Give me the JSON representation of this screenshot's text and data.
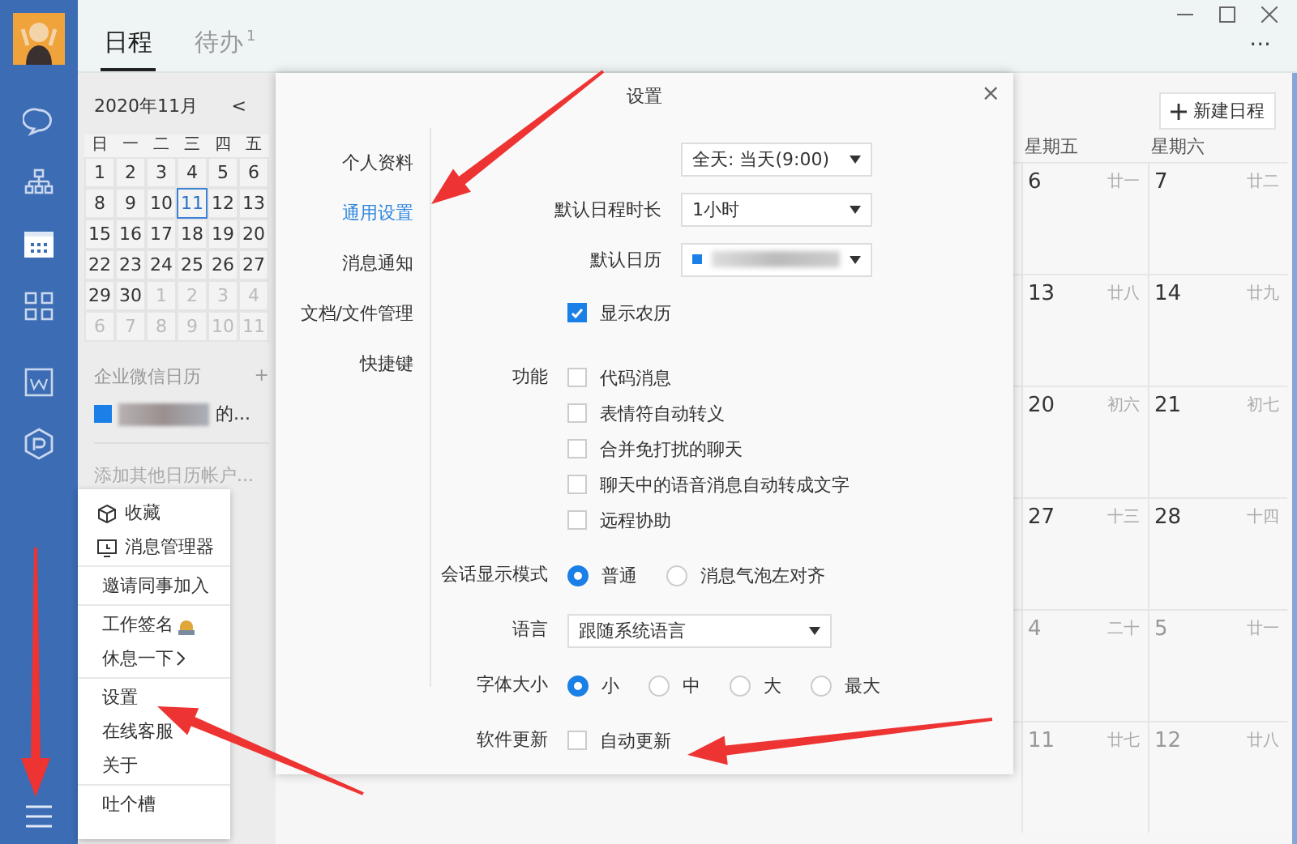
{
  "sidebar": {
    "items": [
      {
        "kind": "chat",
        "selected": false
      },
      {
        "kind": "org",
        "selected": false
      },
      {
        "kind": "calendar",
        "selected": true
      },
      {
        "kind": "apps",
        "selected": false
      },
      {
        "kind": "document",
        "selected": false
      },
      {
        "kind": "hexagon",
        "selected": false
      }
    ]
  },
  "tabs": [
    {
      "label": "日程",
      "selected": true
    },
    {
      "label": "待办",
      "badge": "1",
      "selected": false
    }
  ],
  "more_button": "···",
  "mini_calendar": {
    "month": "2020年11月",
    "prev": "<",
    "weekdays": [
      "日",
      "一",
      "二",
      "三",
      "四",
      "五"
    ],
    "weeks": [
      [
        {
          "day": "1",
          "other_month": false,
          "selected": false
        },
        {
          "day": "2",
          "other_month": false,
          "selected": false
        },
        {
          "day": "3",
          "other_month": false,
          "selected": false
        },
        {
          "day": "4",
          "other_month": false,
          "selected": false
        },
        {
          "day": "5",
          "other_month": false,
          "selected": false
        },
        {
          "day": "6",
          "other_month": false,
          "selected": false
        }
      ],
      [
        {
          "day": "8",
          "other_month": false,
          "selected": false
        },
        {
          "day": "9",
          "other_month": false,
          "selected": false
        },
        {
          "day": "10",
          "other_month": false,
          "selected": false
        },
        {
          "day": "11",
          "other_month": false,
          "selected": true
        },
        {
          "day": "12",
          "other_month": false,
          "selected": false
        },
        {
          "day": "13",
          "other_month": false,
          "selected": false
        }
      ],
      [
        {
          "day": "15",
          "other_month": false,
          "selected": false
        },
        {
          "day": "16",
          "other_month": false,
          "selected": false
        },
        {
          "day": "17",
          "other_month": false,
          "selected": false
        },
        {
          "day": "18",
          "other_month": false,
          "selected": false
        },
        {
          "day": "19",
          "other_month": false,
          "selected": false
        },
        {
          "day": "20",
          "other_month": false,
          "selected": false
        }
      ],
      [
        {
          "day": "22",
          "other_month": false,
          "selected": false
        },
        {
          "day": "23",
          "other_month": false,
          "selected": false
        },
        {
          "day": "24",
          "other_month": false,
          "selected": false
        },
        {
          "day": "25",
          "other_month": false,
          "selected": false
        },
        {
          "day": "26",
          "other_month": false,
          "selected": false
        },
        {
          "day": "27",
          "other_month": false,
          "selected": false
        }
      ],
      [
        {
          "day": "29",
          "other_month": false,
          "selected": false
        },
        {
          "day": "30",
          "other_month": false,
          "selected": false
        },
        {
          "day": "1",
          "other_month": true,
          "selected": false
        },
        {
          "day": "2",
          "other_month": true,
          "selected": false
        },
        {
          "day": "3",
          "other_month": true,
          "selected": false
        },
        {
          "day": "4",
          "other_month": true,
          "selected": false
        }
      ],
      [
        {
          "day": "6",
          "other_month": true,
          "selected": false
        },
        {
          "day": "7",
          "other_month": true,
          "selected": false
        },
        {
          "day": "8",
          "other_month": true,
          "selected": false
        },
        {
          "day": "9",
          "other_month": true,
          "selected": false
        },
        {
          "day": "10",
          "other_month": true,
          "selected": false
        },
        {
          "day": "11",
          "other_month": true,
          "selected": false
        }
      ]
    ]
  },
  "calendar_list": {
    "title": "企业微信日历",
    "add": "+",
    "items": [
      {
        "name": "的...",
        "checked": true
      }
    ],
    "add_account": "添加其他日历帐户..."
  },
  "new_event_button": "新建日程",
  "week_grid": {
    "columns": [
      "星期五",
      "星期六"
    ],
    "weeks": [
      [
        {
          "day": "6",
          "lunar": "廿一",
          "other_month": false
        },
        {
          "day": "7",
          "lunar": "廿二",
          "other_month": false
        }
      ],
      [
        {
          "day": "13",
          "lunar": "廿八",
          "other_month": false
        },
        {
          "day": "14",
          "lunar": "廿九",
          "other_month": false
        }
      ],
      [
        {
          "day": "20",
          "lunar": "初六",
          "other_month": false
        },
        {
          "day": "21",
          "lunar": "初七",
          "other_month": false
        }
      ],
      [
        {
          "day": "27",
          "lunar": "十三",
          "other_month": false
        },
        {
          "day": "28",
          "lunar": "十四",
          "other_month": false
        }
      ],
      [
        {
          "day": "4",
          "lunar": "二十",
          "other_month": true
        },
        {
          "day": "5",
          "lunar": "廿一",
          "other_month": true
        }
      ],
      [
        {
          "day": "11",
          "lunar": "廿七",
          "other_month": true
        },
        {
          "day": "12",
          "lunar": "廿八",
          "other_month": true
        }
      ]
    ]
  },
  "settings_dialog": {
    "title": "设置",
    "close": "×",
    "nav": [
      {
        "label": "个人资料",
        "selected": false
      },
      {
        "label": "通用设置",
        "selected": true
      },
      {
        "label": "消息通知",
        "selected": false
      },
      {
        "label": "文档/文件管理",
        "selected": false
      },
      {
        "label": "快捷键",
        "selected": false
      }
    ],
    "top_rows": [
      {
        "kind": "select",
        "value": "全天: 当天(9:00)",
        "redacted": false
      },
      {
        "kind": "select",
        "label": "默认日程时长",
        "value": "1小时",
        "redacted": false
      },
      {
        "kind": "select",
        "label": "默认日历",
        "color": "#1a7fe6",
        "redacted": true
      }
    ],
    "rows": [
      {
        "kind": "checkbox",
        "options": [
          {
            "label": "显示农历",
            "checked": true
          }
        ]
      },
      {
        "kind": "checkbox",
        "label": "功能",
        "options": [
          {
            "label": "代码消息",
            "checked": false
          },
          {
            "label": "表情符自动转义",
            "checked": false
          },
          {
            "label": "合并免打扰的聊天",
            "checked": false
          },
          {
            "label": "聊天中的语音消息自动转成文字",
            "checked": false
          },
          {
            "label": "远程协助",
            "checked": false
          }
        ]
      },
      {
        "kind": "radio",
        "label": "会话显示模式",
        "options": [
          {
            "label": "普通",
            "selected": true
          },
          {
            "label": "消息气泡左对齐",
            "selected": false
          }
        ]
      },
      {
        "kind": "select",
        "label": "语言",
        "value": "跟随系统语言",
        "redacted": false
      },
      {
        "kind": "radio",
        "label": "字体大小",
        "options": [
          {
            "label": "小",
            "selected": true
          },
          {
            "label": "中",
            "selected": false
          },
          {
            "label": "大",
            "selected": false
          },
          {
            "label": "最大",
            "selected": false
          }
        ]
      },
      {
        "kind": "checkbox",
        "label": "软件更新",
        "options": [
          {
            "label": "自动更新",
            "checked": false
          }
        ]
      }
    ]
  },
  "menu": {
    "groups": [
      [
        {
          "label": "收藏",
          "kind": "cube"
        },
        {
          "label": "消息管理器",
          "kind": "monitor"
        }
      ],
      [
        {
          "label": "邀请同事加入"
        }
      ],
      [
        {
          "label": "工作签名",
          "kind": "badge"
        },
        {
          "label": "休息一下",
          "submenu": true
        }
      ],
      [
        {
          "label": "设置"
        },
        {
          "label": "在线客服"
        },
        {
          "label": "关于"
        }
      ],
      [
        {
          "label": "吐个槽"
        }
      ]
    ]
  }
}
